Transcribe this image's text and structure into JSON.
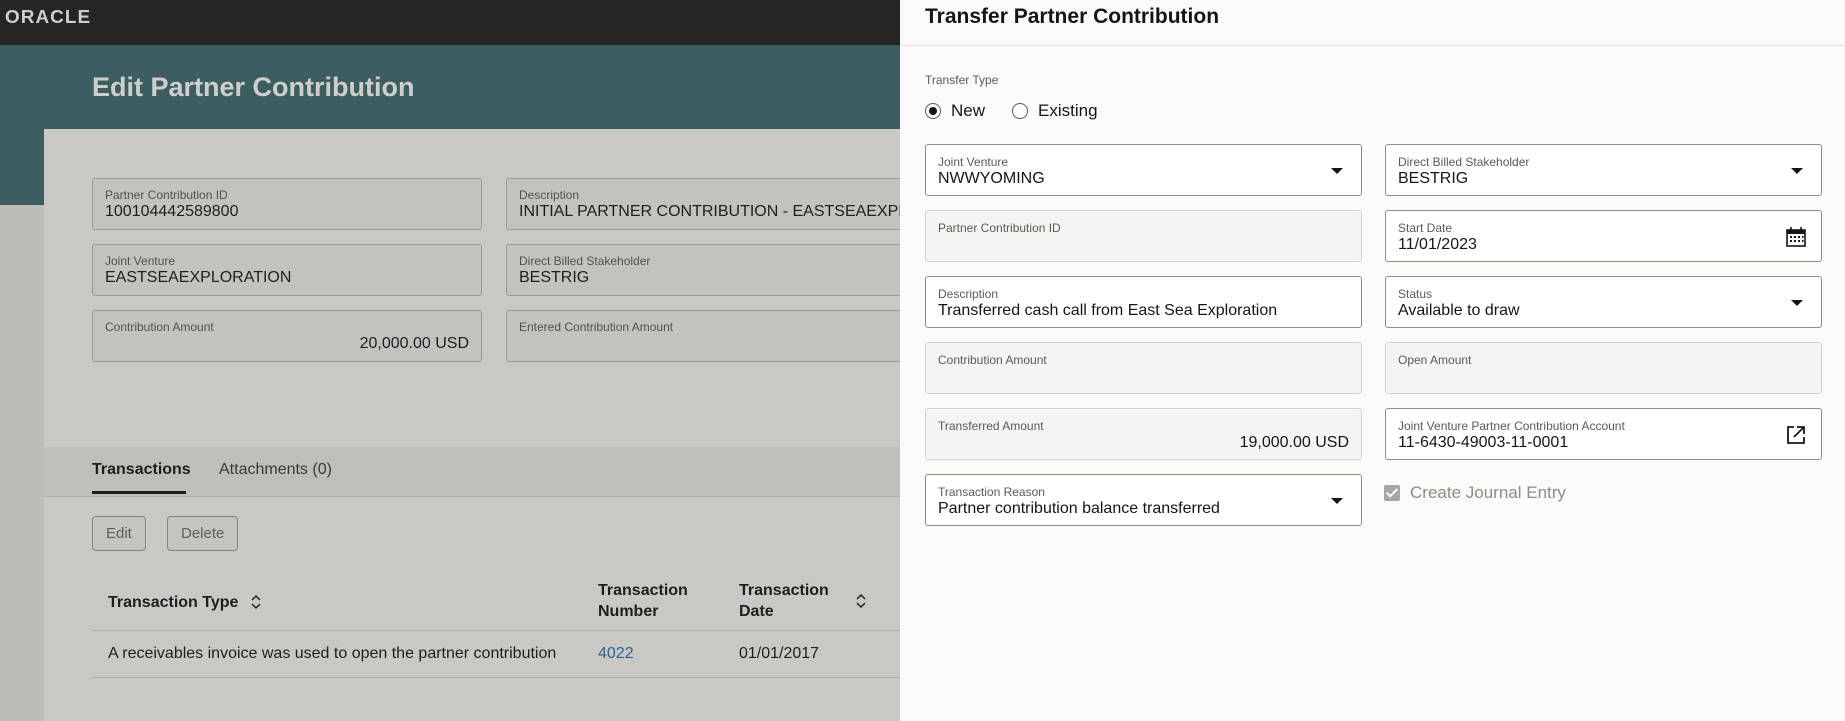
{
  "app": {
    "logo": "ORACLE"
  },
  "background_page": {
    "title": "Edit Partner Contribution",
    "fields": {
      "partner_contribution_id": {
        "label": "Partner Contribution ID",
        "value": "100104442589800"
      },
      "description": {
        "label": "Description",
        "value": "INITIAL PARTNER CONTRIBUTION - EASTSEAEXPLO"
      },
      "joint_venture": {
        "label": "Joint Venture",
        "value": "EASTSEAEXPLORATION"
      },
      "direct_billed_stakeholder": {
        "label": "Direct Billed Stakeholder",
        "value": "BESTRIG"
      },
      "contribution_amount": {
        "label": "Contribution Amount",
        "value": "20,000.00 USD"
      },
      "entered_contribution_amount": {
        "label": "Entered Contribution Amount",
        "value": ""
      }
    },
    "tabs": [
      {
        "label": "Transactions"
      },
      {
        "label": "Attachments (0)"
      }
    ],
    "buttons": {
      "edit": "Edit",
      "delete": "Delete"
    },
    "table": {
      "headers": {
        "transaction_type": "Transaction Type",
        "transaction_number_1": "Transaction",
        "transaction_number_2": "Number",
        "transaction_date_1": "Transaction",
        "transaction_date_2": "Date"
      },
      "rows": [
        {
          "type": "A receivables invoice was used to open the partner contribution",
          "number": "4022",
          "date": "01/01/2017"
        }
      ]
    }
  },
  "drawer": {
    "title": "Transfer Partner Contribution",
    "transfer_type": {
      "label": "Transfer Type",
      "options": [
        "New",
        "Existing"
      ],
      "selected": "New"
    },
    "fields": {
      "joint_venture": {
        "label": "Joint Venture",
        "value": "NWWYOMING"
      },
      "direct_billed_stakeholder": {
        "label": "Direct Billed Stakeholder",
        "value": "BESTRIG"
      },
      "partner_contribution_id": {
        "label": "Partner Contribution ID",
        "value": ""
      },
      "start_date": {
        "label": "Start Date",
        "value": "11/01/2023"
      },
      "description": {
        "label": "Description",
        "value": "Transferred cash call from East Sea Exploration"
      },
      "status": {
        "label": "Status",
        "value": "Available to draw"
      },
      "contribution_amount": {
        "label": "Contribution Amount",
        "value": ""
      },
      "open_amount": {
        "label": "Open Amount",
        "value": ""
      },
      "transferred_amount": {
        "label": "Transferred Amount",
        "value": "19,000.00 USD"
      },
      "jv_partner_contribution_account": {
        "label": "Joint Venture Partner Contribution Account",
        "value": "11-6430-49003-11-0001"
      },
      "transaction_reason": {
        "label": "Transaction Reason",
        "value": "Partner contribution balance transferred"
      }
    },
    "create_journal_entry": {
      "label": "Create Journal Entry",
      "checked": true
    }
  },
  "colors": {
    "banner": "#3e6a6f",
    "topbar": "#201e1c",
    "link": "#2a6db3"
  }
}
